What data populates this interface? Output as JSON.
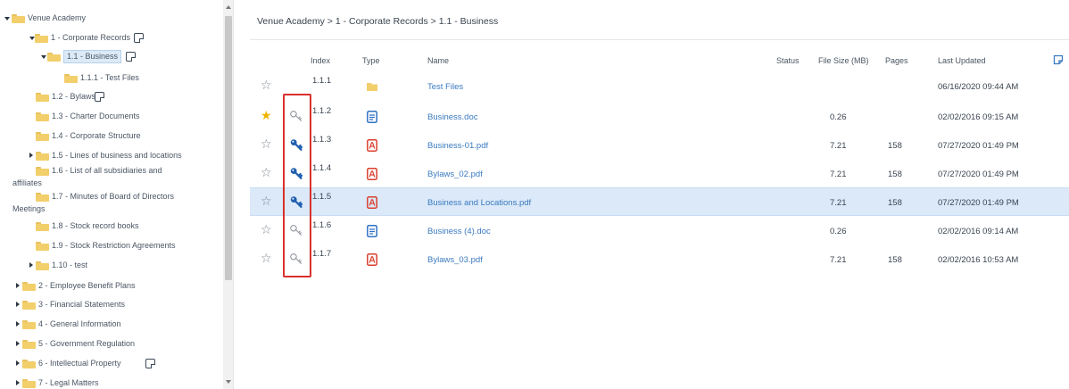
{
  "sidebar": {
    "items": [
      {
        "label": "Venue Academy",
        "caret": "down"
      },
      {
        "label": "1 - Corporate Records",
        "caret": "down",
        "doc_icon": "document-icon"
      },
      {
        "label": "1.1 - Business",
        "caret": "down",
        "selected": true,
        "doc_icon": "document-icon"
      },
      {
        "label": "1.1.1 - Test Files"
      },
      {
        "label": "1.2 - Bylaws",
        "doc_icon": "document-icon"
      },
      {
        "label": "1.3 - Charter Documents"
      },
      {
        "label": "1.4 - Corporate Structure"
      },
      {
        "label": "1.5 - Lines of business and locations",
        "caret": "right"
      },
      {
        "label": "1.6 - List of all subsidiaries and",
        "label2": "affiliates"
      },
      {
        "label": "1.7 - Minutes of Board of Directors",
        "label2": "Meetings"
      },
      {
        "label": "1.8 - Stock record books"
      },
      {
        "label": "1.9 - Stock Restriction Agreements"
      },
      {
        "label": "1.10 - test",
        "caret": "right"
      },
      {
        "label": "2 - Employee Benefit Plans",
        "caret": "right"
      },
      {
        "label": "3 - Financial Statements",
        "caret": "right"
      },
      {
        "label": "4 - General Information",
        "caret": "right"
      },
      {
        "label": "5 - Government Regulation",
        "caret": "right"
      },
      {
        "label": "6 - Intellectual Property",
        "caret": "right",
        "doc_icon": "document-icon"
      },
      {
        "label": "7 - Legal Matters",
        "caret": "right"
      }
    ]
  },
  "breadcrumb": "Venue Academy > 1 - Corporate Records > 1.1 - Business",
  "table": {
    "headers": {
      "index": "Index",
      "type": "Type",
      "name": "Name",
      "status": "Status",
      "size": "File Size (MB)",
      "pages": "Pages",
      "updated": "Last Updated"
    },
    "rows": [
      {
        "index": "1.1.1",
        "type": "folder",
        "name": "Test Files",
        "size": "",
        "pages": "",
        "updated": "06/16/2020 09:44 AM",
        "starred": false,
        "key": "none",
        "selected": false
      },
      {
        "index": "1.1.2",
        "type": "doc",
        "name": "Business.doc",
        "size": "0.26",
        "pages": "",
        "updated": "02/02/2016 09:15 AM",
        "starred": true,
        "key": "outline",
        "selected": false
      },
      {
        "index": "1.1.3",
        "type": "pdf",
        "name": "Business-01.pdf",
        "size": "7.21",
        "pages": "158",
        "updated": "07/27/2020 01:49 PM",
        "starred": false,
        "key": "filled",
        "selected": false
      },
      {
        "index": "1.1.4",
        "type": "pdf",
        "name": "Bylaws_02.pdf",
        "size": "7.21",
        "pages": "158",
        "updated": "07/27/2020 01:49 PM",
        "starred": false,
        "key": "filled",
        "selected": false
      },
      {
        "index": "1.1.5",
        "type": "pdf",
        "name": "Business and Locations.pdf",
        "size": "7.21",
        "pages": "158",
        "updated": "07/27/2020 01:49 PM",
        "starred": false,
        "key": "filled",
        "selected": true
      },
      {
        "index": "1.1.6",
        "type": "doc",
        "name": "Business (4).doc",
        "size": "0.26",
        "pages": "",
        "updated": "02/02/2016 09:14 AM",
        "starred": false,
        "key": "outline",
        "selected": false
      },
      {
        "index": "1.1.7",
        "type": "pdf",
        "name": "Bylaws_03.pdf",
        "size": "7.21",
        "pages": "158",
        "updated": "02/02/2016 10:53 AM",
        "starred": false,
        "key": "outline",
        "selected": false
      }
    ]
  },
  "colors": {
    "accent": "#1f5fb0",
    "link": "#3a7ac0",
    "selected_row": "#dbe9f8",
    "star_on": "#f0b400",
    "highlight": "#d9302c",
    "pdf": "#d9402f",
    "doc": "#2f72c4",
    "folder": "#f2cf6b"
  }
}
